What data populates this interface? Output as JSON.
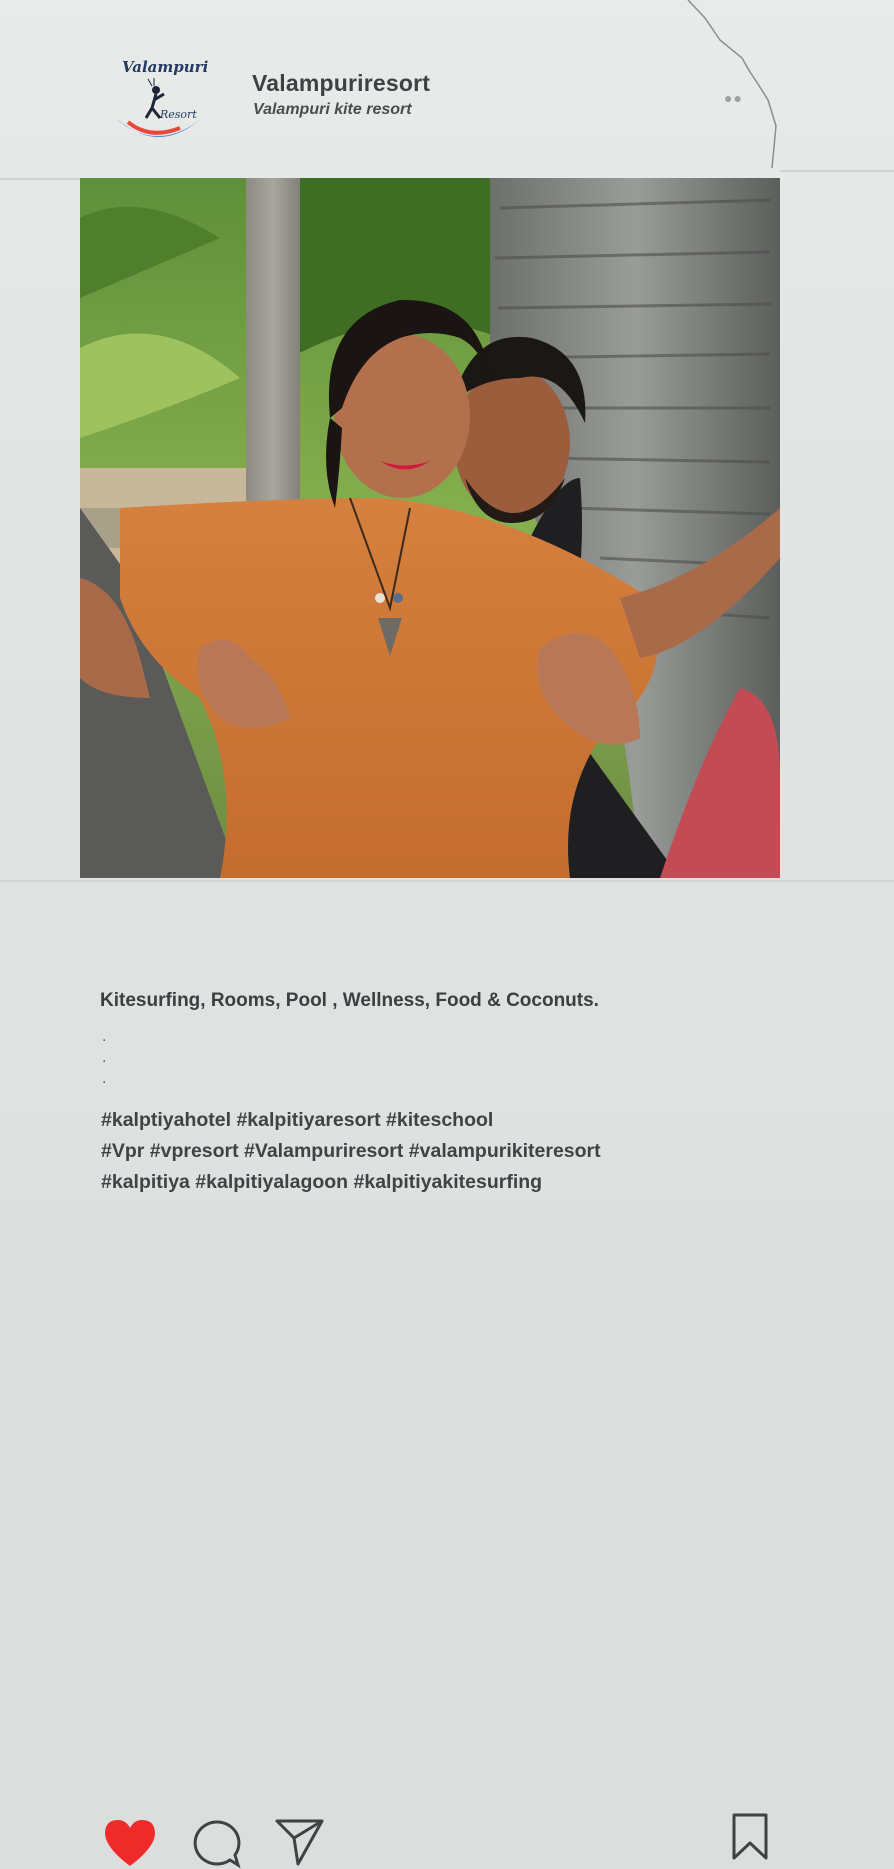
{
  "header": {
    "logo_text": "Valampuri",
    "logo_subtext": "Resort",
    "account_name": "Valampuriresort",
    "account_subtitle": "Valampuri kite resort"
  },
  "photo": {
    "subject": "couple posing in front of palm trees"
  },
  "actions": {
    "like_icon": "heart-icon",
    "comment_icon": "comment-icon",
    "share_icon": "send-icon",
    "save_icon": "bookmark-icon",
    "like_color": "#ee2a2a"
  },
  "caption": {
    "text": "Kitesurfing, Rooms, Pool , Wellness, Food &  Coconuts.",
    "dots": [
      ".",
      ".",
      "."
    ]
  },
  "hashtags": [
    "#kalptiyahotel #kalpitiyaresort #kiteschool",
    "#Vpr #vpresort #Valampuriresort #valampurikiteresort",
    "#kalpitiya #kalpitiyalagoon #kalpitiyakitesurfing"
  ]
}
